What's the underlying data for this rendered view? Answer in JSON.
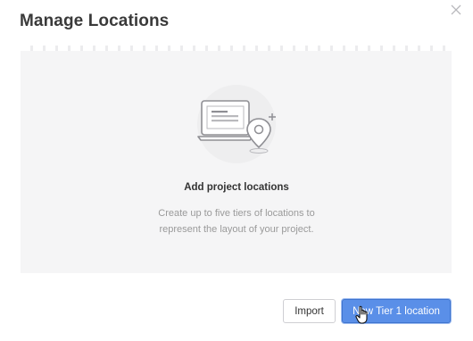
{
  "dialog": {
    "title": "Manage Locations"
  },
  "empty_state": {
    "heading": "Add project locations",
    "description_line1": "Create up to five tiers of locations to",
    "description_line2": "represent the layout of your project."
  },
  "footer": {
    "import_label": "Import",
    "new_location_label": "New Tier 1 location"
  },
  "icons": {
    "close": "close-icon",
    "illustration": "laptop-location-pin-illustration",
    "cursor": "hand-pointer-cursor"
  },
  "colors": {
    "primary": "#5a8fe8",
    "panel_bg": "#f5f5f6",
    "title": "#3a3a3a",
    "muted_text": "#9a9a9a"
  }
}
